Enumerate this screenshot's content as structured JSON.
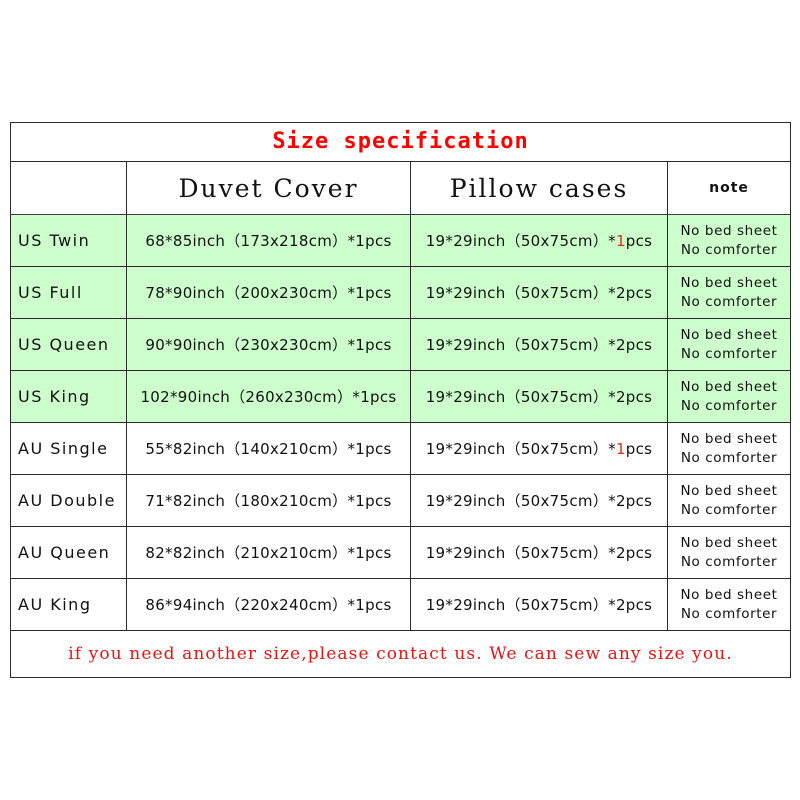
{
  "title": "Size specification",
  "colors": {
    "green_row": "#CCFFCC",
    "white_row": "#FFFFFF",
    "title_text": "#FF0000",
    "footer_text": "#EE1111",
    "highlight_qty": "#E03010",
    "border": "#2B2B2B"
  },
  "header": {
    "blank": "",
    "duvet": "Duvet Cover",
    "pillow": "Pillow cases",
    "note": "note"
  },
  "note_default": {
    "line1": "No bed sheet",
    "line2": "No comforter"
  },
  "rows": [
    {
      "label": "US Twin",
      "band": "green",
      "duvet": "68*85inch（173x218cm）*1pcs",
      "pillow_prefix": "19*29inch（50x75cm）*",
      "pillow_qty": "1",
      "pillow_suffix": "pcs",
      "pillow_qty_highlighted": true,
      "note_line1": "No bed sheet",
      "note_line2": "No comforter"
    },
    {
      "label": "US Full",
      "band": "green",
      "duvet": "78*90inch（200x230cm）*1pcs",
      "pillow_prefix": "19*29inch（50x75cm）*",
      "pillow_qty": "2",
      "pillow_suffix": "pcs",
      "pillow_qty_highlighted": false,
      "note_line1": "No bed sheet",
      "note_line2": "No comforter"
    },
    {
      "label": "US Queen",
      "band": "green",
      "duvet": "90*90inch（230x230cm）*1pcs",
      "pillow_prefix": "19*29inch（50x75cm）*",
      "pillow_qty": "2",
      "pillow_suffix": "pcs",
      "pillow_qty_highlighted": false,
      "note_line1": "No bed sheet",
      "note_line2": "No comforter"
    },
    {
      "label": "US King",
      "band": "green",
      "duvet": "102*90inch（260x230cm）*1pcs",
      "pillow_prefix": "19*29inch（50x75cm）*",
      "pillow_qty": "2",
      "pillow_suffix": "pcs",
      "pillow_qty_highlighted": false,
      "note_line1": "No bed sheet",
      "note_line2": "No comforter"
    },
    {
      "label": "AU Single",
      "band": "white",
      "duvet": "55*82inch（140x210cm）*1pcs",
      "pillow_prefix": "19*29inch（50x75cm）*",
      "pillow_qty": "1",
      "pillow_suffix": "pcs",
      "pillow_qty_highlighted": true,
      "note_line1": "No bed sheet",
      "note_line2": "No comforter"
    },
    {
      "label": "AU Double",
      "band": "white",
      "duvet": "71*82inch（180x210cm）*1pcs",
      "pillow_prefix": "19*29inch（50x75cm）*",
      "pillow_qty": "2",
      "pillow_suffix": "pcs",
      "pillow_qty_highlighted": false,
      "note_line1": "No bed sheet",
      "note_line2": "No comforter"
    },
    {
      "label": "AU Queen",
      "band": "white",
      "duvet": "82*82inch（210x210cm）*1pcs",
      "pillow_prefix": "19*29inch（50x75cm）*",
      "pillow_qty": "2",
      "pillow_suffix": "pcs",
      "pillow_qty_highlighted": false,
      "note_line1": "No bed sheet",
      "note_line2": "No comforter"
    },
    {
      "label": "AU King",
      "band": "white",
      "duvet": "86*94inch（220x240cm）*1pcs",
      "pillow_prefix": "19*29inch（50x75cm）*",
      "pillow_qty": "2",
      "pillow_suffix": "pcs",
      "pillow_qty_highlighted": false,
      "note_line1": "No bed sheet",
      "note_line2": "No comforter"
    }
  ],
  "footer": "if you need another size,please contact us. We can sew any size you."
}
